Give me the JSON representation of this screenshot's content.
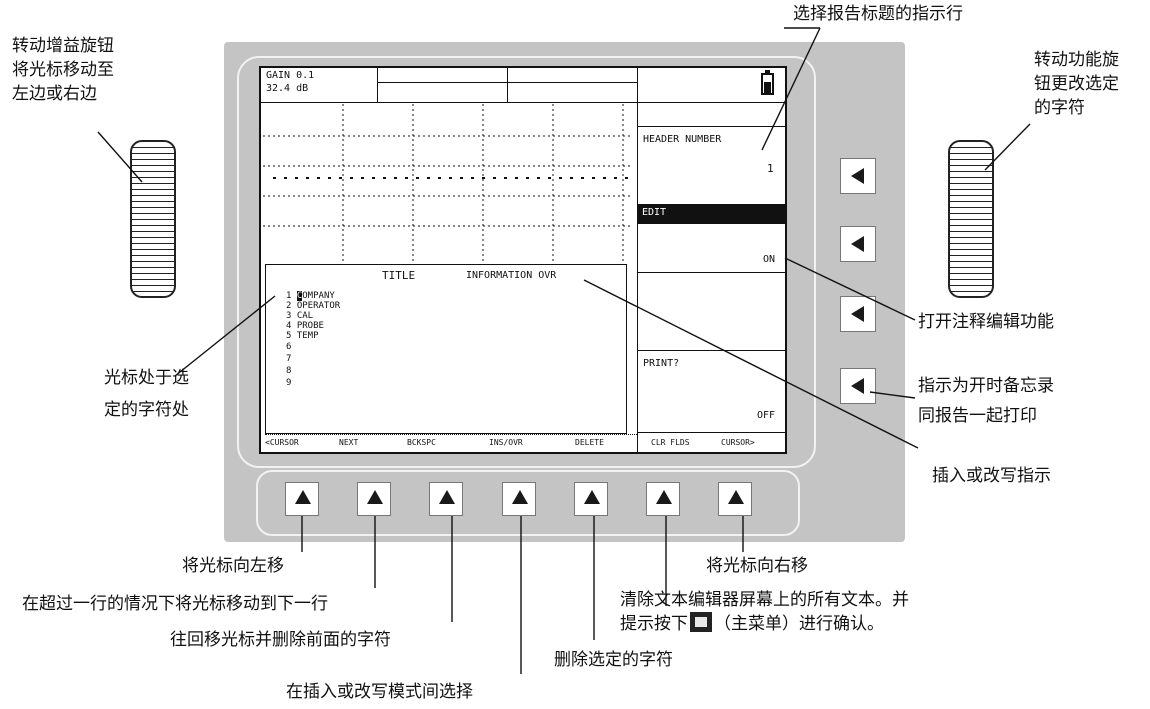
{
  "screen": {
    "gain_label": "GAIN 0.1",
    "gain_value": "32.4 dB",
    "editor": {
      "title": "TITLE",
      "info": "INFORMATION OVR",
      "cursor_char": "C",
      "lines": [
        "1 COMPANY",
        "2 OPERATOR",
        "3 CAL",
        "4 PROBE",
        "5 TEMP",
        "6",
        "7",
        "8",
        "9"
      ]
    },
    "menu": {
      "header_number_label": "HEADER NUMBER",
      "header_number_value": "1",
      "edit_label": "EDIT",
      "edit_value": "ON",
      "print_label": "PRINT?",
      "print_value": "OFF"
    },
    "softkeys": [
      "<CURSOR",
      "NEXT",
      "BCKSPC",
      "INS/OVR",
      "DELETE",
      "CLR FLDS",
      "CURSOR>"
    ]
  },
  "annotations": {
    "left_knob": [
      "转动增益旋钮",
      "将光标移动至",
      "左边或右边"
    ],
    "right_knob": [
      "转动功能旋",
      "钮更改选定",
      "的字符"
    ],
    "header_line": "选择报告标题的指示行",
    "edit_on": "打开注释编辑功能",
    "print_memo": [
      "指示为开时备忘录",
      "同报告一起打印"
    ],
    "ins_ovr_indicator": "插入或改写指示",
    "cursor_position": [
      "光标处于选",
      "定的字符处"
    ],
    "cursor_left": "将光标向左移",
    "cursor_right": "将光标向右移",
    "next_line": "在超过一行的情况下将光标移动到下一行",
    "backspace": "往回移光标并删除前面的字符",
    "clear_fields_1": "清除文本编辑器屏幕上的所有文本。并",
    "clear_fields_2a": "提示按下",
    "clear_fields_2b": "（主菜单）进行确认。",
    "delete_char": "删除选定的字符",
    "ins_ovr_mode": "在插入或改写模式间选择"
  }
}
